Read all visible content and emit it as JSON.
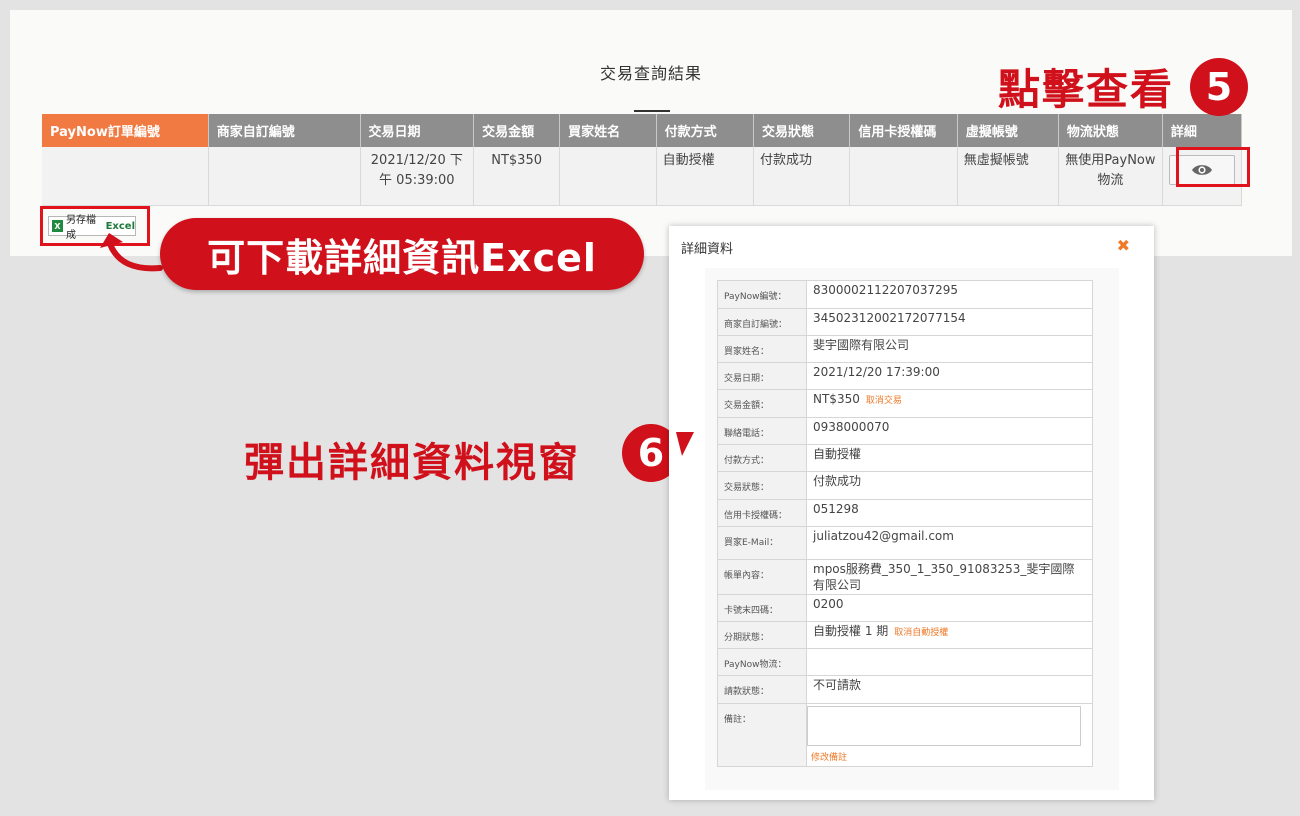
{
  "result_title": "交易查詢結果",
  "table": {
    "headers": [
      "PayNow訂單編號",
      "商家自訂編號",
      "交易日期",
      "交易金額",
      "買家姓名",
      "付款方式",
      "交易狀態",
      "信用卡授權碼",
      "虛擬帳號",
      "物流狀態",
      "詳細"
    ],
    "row": {
      "paynow_order": "",
      "merchant_id": "",
      "date": "2021/12/20 下午 05:39:00",
      "amount": "NT$350",
      "buyer": "",
      "payment": "自動授權",
      "status": "付款成功",
      "auth_code": "",
      "virtual_account": "無虛擬帳號",
      "logistics": "無使用PayNow 物流",
      "detail_icon": "eye-icon"
    }
  },
  "excel_button": {
    "label_prefix": "另存檔成",
    "label_suffix": "Excel",
    "icon": "excel-icon",
    "icon_text": "X"
  },
  "callouts": {
    "click_view": "點擊查看",
    "click_view_step": "5",
    "download_excel": "可下載詳細資訊Excel",
    "popup_detail": "彈出詳細資料視窗",
    "popup_step": "6"
  },
  "modal": {
    "title": "詳細資料",
    "close_icon": "close-icon",
    "close_glyph": "✖",
    "rows": [
      {
        "label": "PayNow編號：",
        "value": "8300002112207037295"
      },
      {
        "label": "商家自訂編號：",
        "value": "3450231200217207715​4"
      },
      {
        "label": "買家姓名：",
        "value": "斐宇國際有限公司"
      },
      {
        "label": "交易日期：",
        "value": "2021/12/20 17:39:00"
      },
      {
        "label": "交易金額：",
        "value": "NT$350",
        "link": "取消交易"
      },
      {
        "label": "聯絡電話：",
        "value": "0938000070"
      },
      {
        "label": "付款方式：",
        "value": "自動授權"
      },
      {
        "label": "交易狀態：",
        "value": "付款成功"
      },
      {
        "label": "信用卡授權碼：",
        "value": "051298"
      },
      {
        "label": "買家E-Mail：",
        "value": "juliatzou42@gmail.com"
      },
      {
        "label": "帳單內容：",
        "value": "mpos服務費_350_1_350_91083253_斐宇國際有限公司"
      },
      {
        "label": "卡號末四碼：",
        "value": "0200"
      },
      {
        "label": "分期狀態：",
        "value": "自動授權 1 期",
        "link": "取消自動授權"
      },
      {
        "label": "PayNow物流：",
        "value": ""
      },
      {
        "label": "請款狀態：",
        "value": "不可請款"
      },
      {
        "label": "備註：",
        "value": "",
        "link": "修改備註"
      }
    ]
  },
  "colors": {
    "accent_red": "#d0101a",
    "header_orange": "#f07a42",
    "header_gray": "#8e8e8e",
    "link_orange": "#ee7a2a"
  }
}
